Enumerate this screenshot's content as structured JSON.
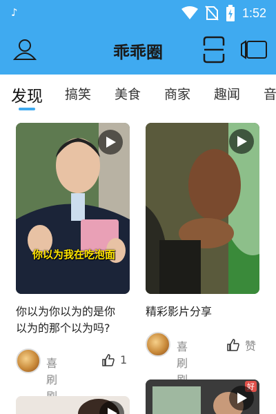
{
  "status_bar": {
    "time": "1:52",
    "app_icon": "music-note-icon",
    "icons": [
      "wifi-icon",
      "no-sim-icon",
      "battery-icon"
    ]
  },
  "header": {
    "title": "乖乖圈",
    "left_icon": "user-icon",
    "right_icons": [
      "scan-icon",
      "video-camera-icon"
    ]
  },
  "tabs": [
    {
      "label": "发现",
      "active": true
    },
    {
      "label": "搞笑",
      "active": false
    },
    {
      "label": "美食",
      "active": false
    },
    {
      "label": "商家",
      "active": false
    },
    {
      "label": "趣闻",
      "active": false
    },
    {
      "label": "音",
      "active": false
    }
  ],
  "feed": [
    {
      "caption": "你以为我在吃泡面",
      "title_line1": "你以为你以为的是你",
      "title_line2": "以为的那个以为吗?",
      "author": "喜刷刷",
      "likes": "1"
    },
    {
      "title_line1": "精彩影片分享",
      "author": "喜刷刷",
      "likes": "赞"
    },
    {
      "badge": "好"
    }
  ],
  "colors": {
    "primary": "#3faaf0",
    "indicator": "#3faaf0"
  }
}
